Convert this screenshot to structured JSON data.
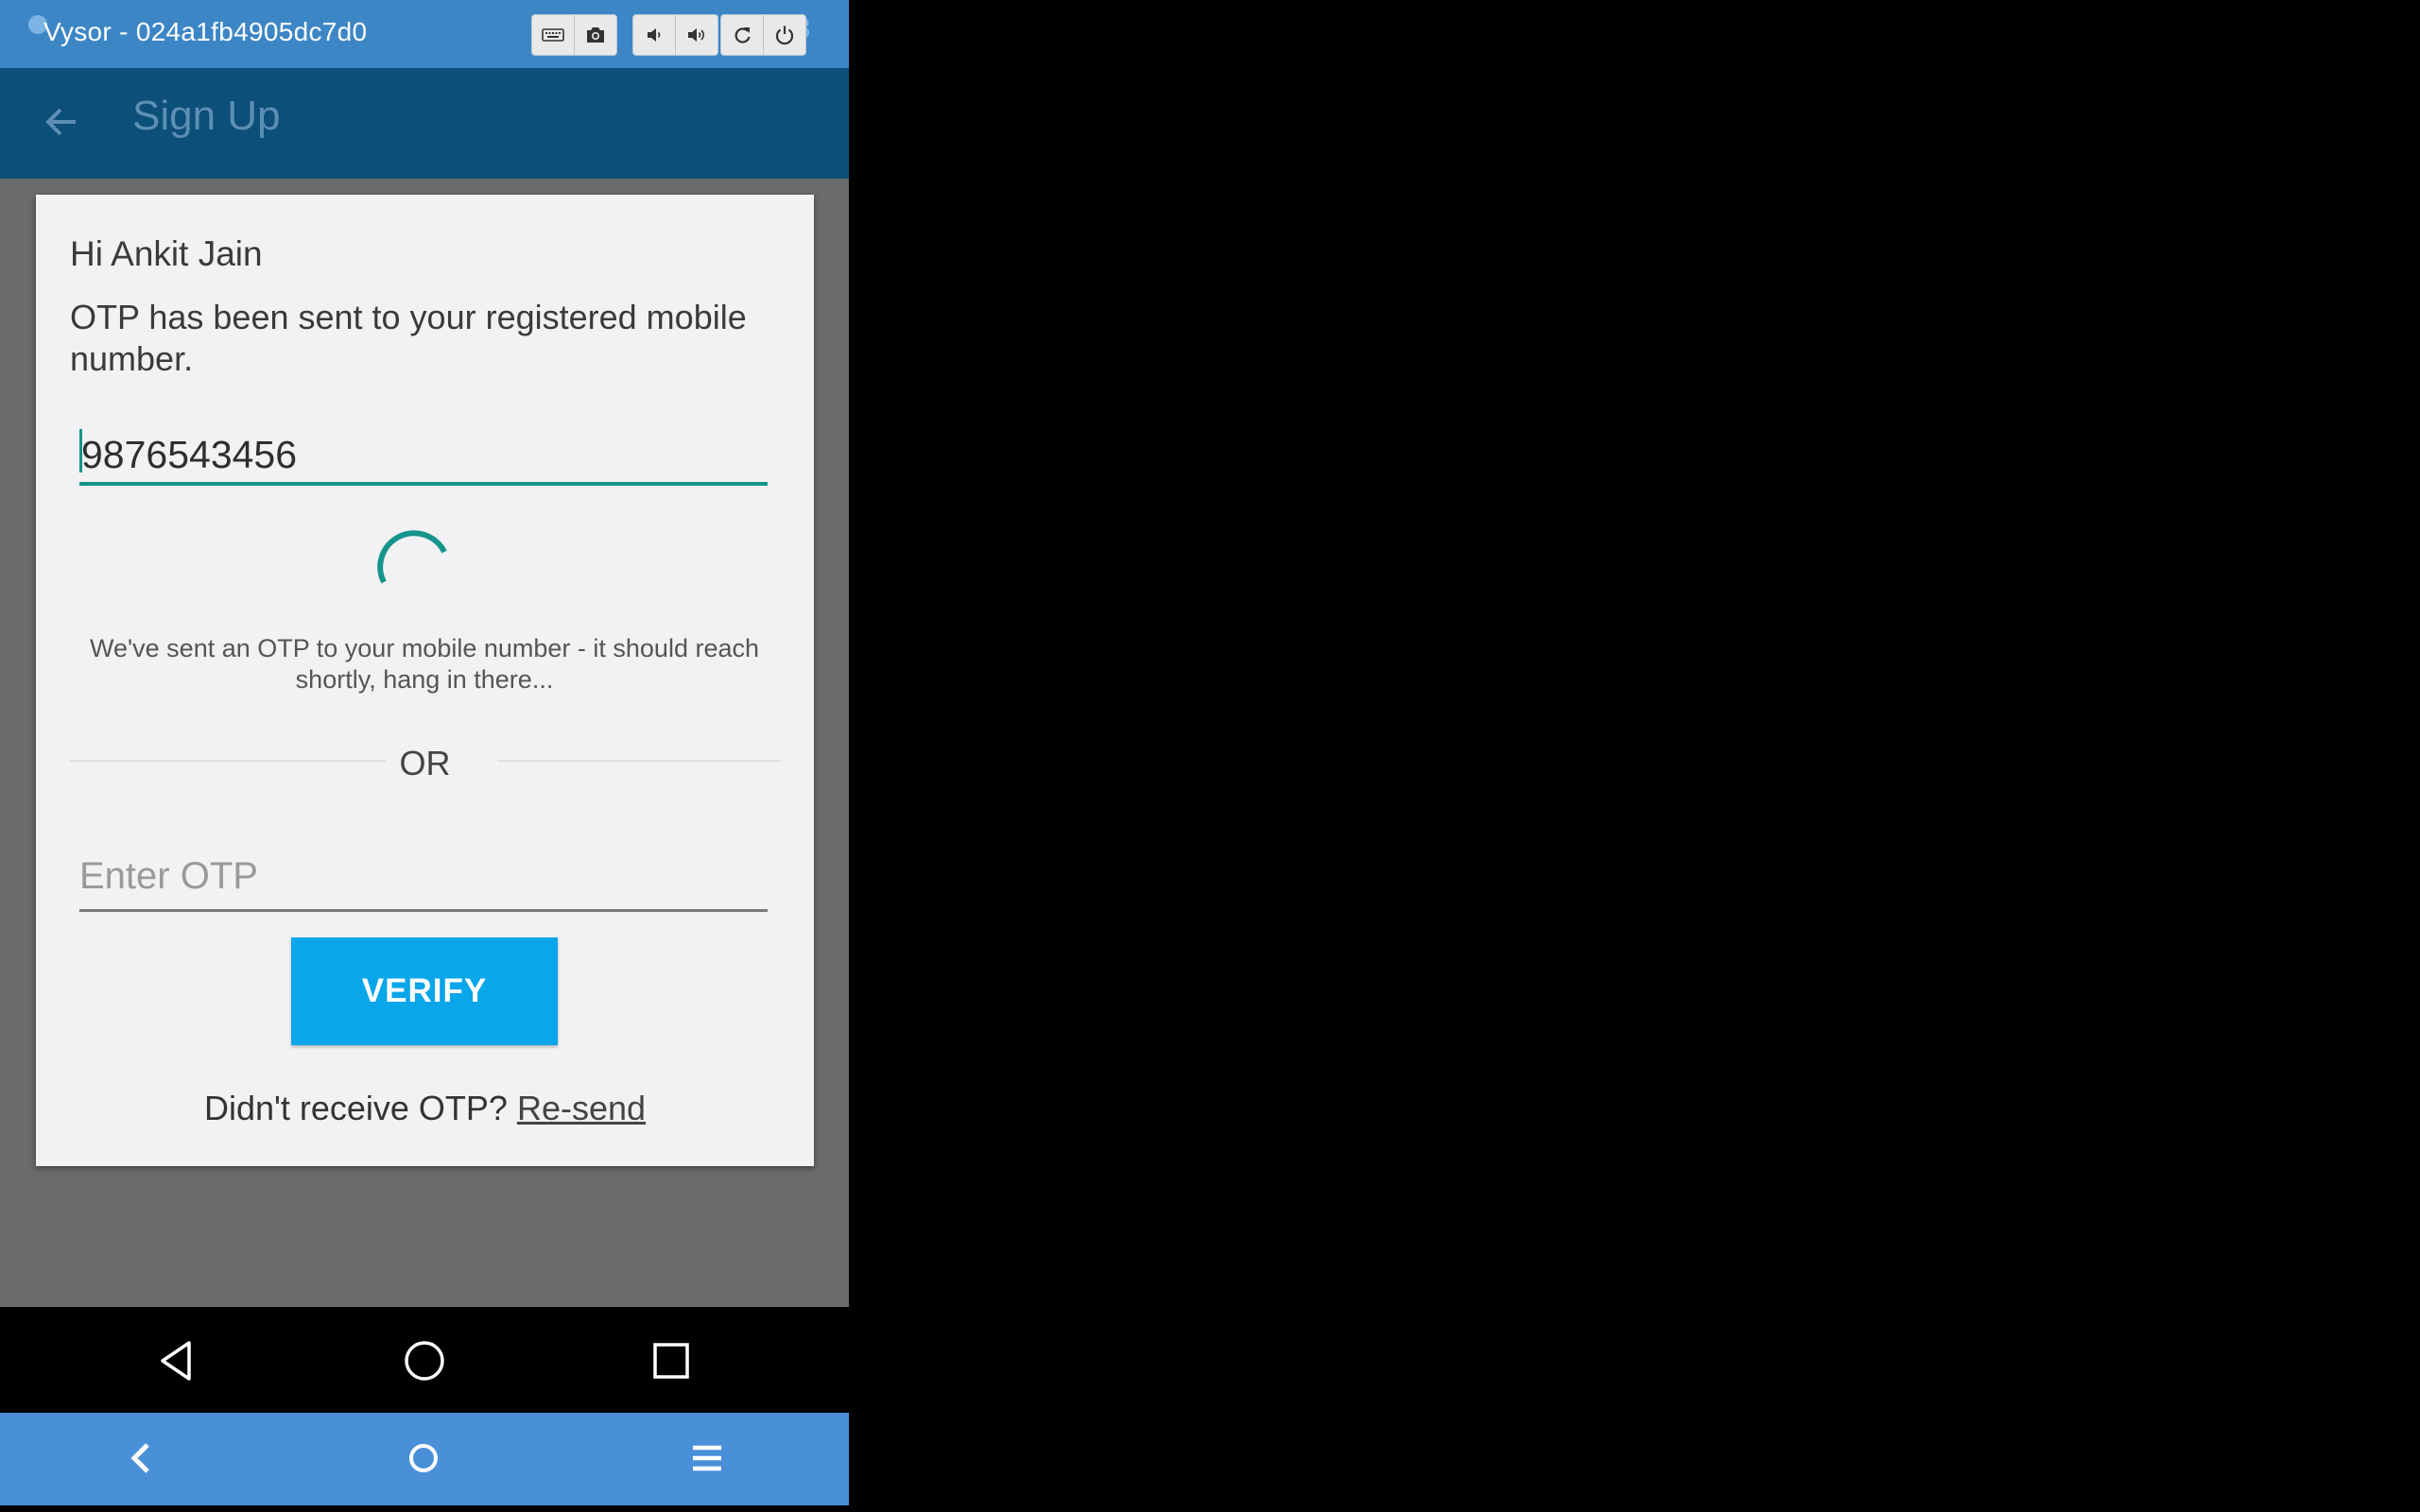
{
  "window": {
    "title": "Vysor  -  024a1fb4905dc7d0",
    "clock_partial": "48",
    "toolbar_icons": [
      "keyboard-icon",
      "camera-icon",
      "volume-down-icon",
      "volume-up-icon",
      "rotate-icon",
      "power-icon"
    ]
  },
  "appbar": {
    "title": "Sign Up",
    "back_icon": "back-arrow-icon"
  },
  "dialog": {
    "greeting": "Hi Ankit Jain",
    "message": "OTP has been sent to your registered mobile number.",
    "mobile_number": "9876543456",
    "wait_message": "We've sent an OTP to your mobile number - it should reach shortly, hang in there...",
    "or_label": "OR",
    "otp_placeholder": "Enter OTP",
    "otp_value": "",
    "verify_label": "VERIFY",
    "resend_prompt": "Didn't receive OTP? ",
    "resend_link": "Re-send"
  },
  "android_nav": [
    "back-triangle-icon",
    "home-circle-icon",
    "recents-square-icon"
  ],
  "vysor_nav": [
    "chevron-left-icon",
    "home-circle-icon",
    "menu-icon"
  ],
  "colors": {
    "titlebar": "#3d86c6",
    "appbar": "#0c4f78",
    "accent_teal": "#14958c",
    "verify_button": "#0aa6ea",
    "vysor_bar": "#4a90d9"
  }
}
